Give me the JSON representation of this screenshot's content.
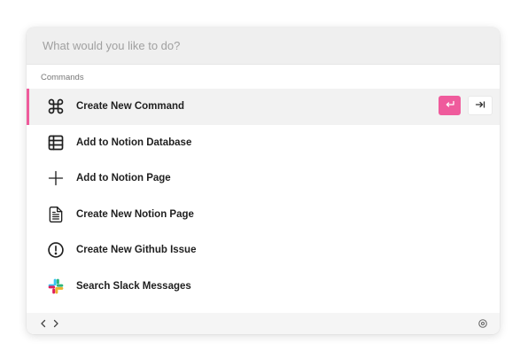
{
  "search": {
    "placeholder": "What would you like to do?"
  },
  "section": {
    "label": "Commands"
  },
  "commands": [
    {
      "label": "Create New Command",
      "icon": "command-icon",
      "active": true
    },
    {
      "label": "Add to Notion Database",
      "icon": "table-icon"
    },
    {
      "label": "Add to Notion Page",
      "icon": "plus-icon"
    },
    {
      "label": "Create New Notion Page",
      "icon": "document-icon"
    },
    {
      "label": "Create New Github Issue",
      "icon": "alert-circle-icon"
    },
    {
      "label": "Search Slack Messages",
      "icon": "slack-icon"
    }
  ],
  "actions": {
    "enter_icon": "enter-key-icon",
    "tab_icon": "tab-key-icon"
  },
  "footer": {
    "back_icon": "chevron-left-icon",
    "forward_icon": "chevron-right-icon",
    "settings_icon": "gear-icon"
  },
  "colors": {
    "accent": "#ef5b9c",
    "search_bg": "#efefef",
    "active_row_bg": "#f2f2f2",
    "footer_bg": "#f5f5f5"
  }
}
